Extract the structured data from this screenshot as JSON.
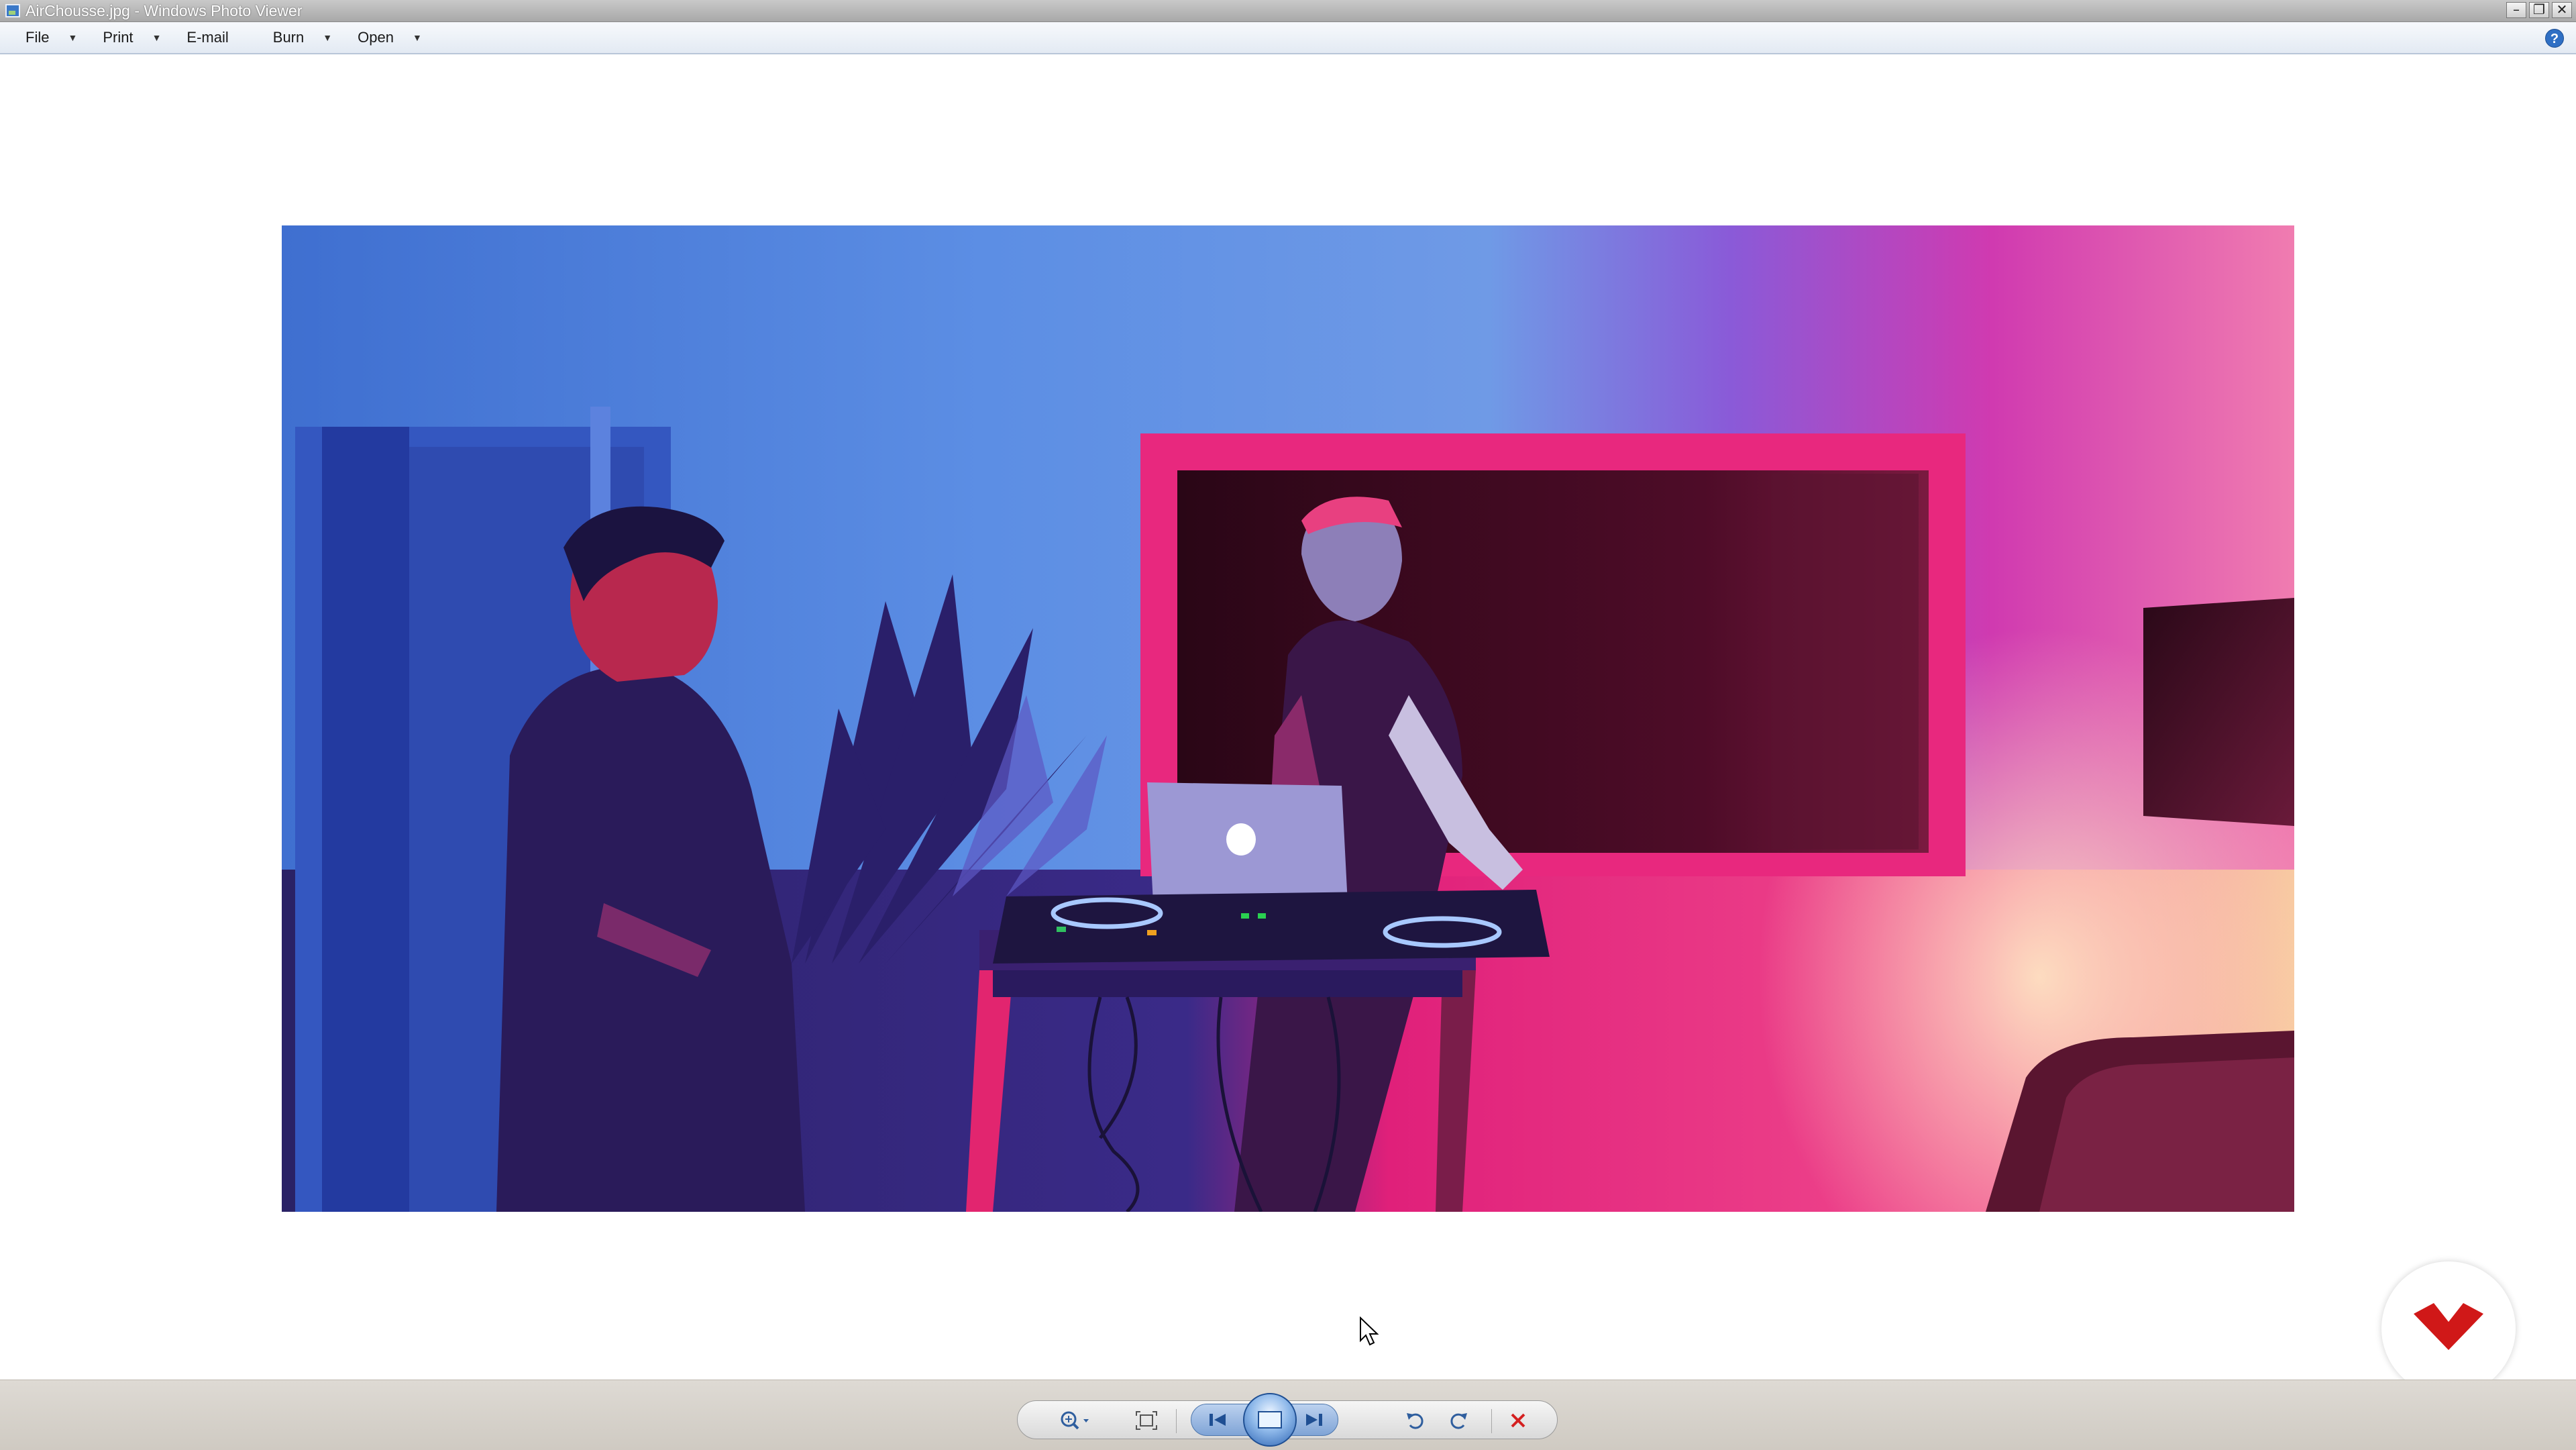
{
  "window": {
    "title": "AirChousse.jpg - Windows Photo Viewer",
    "controls": [
      "minimize-icon",
      "restore-icon",
      "close-icon"
    ]
  },
  "menu": {
    "file": "File",
    "print": "Print",
    "email": "E-mail",
    "burn": "Burn",
    "open": "Open",
    "help_icon": "help-icon"
  },
  "photo": {
    "description_icon": "image",
    "palette": {
      "blue": "#4f86e0",
      "deep_blue": "#2b3a9e",
      "navy": "#2a1e5c",
      "magenta": "#e8237c",
      "pink": "#f060a0",
      "cream": "#f8e6b0",
      "maroon": "#4a0a26"
    }
  },
  "toolbar": {
    "buttons": [
      "zoom-icon",
      "actual-size-icon",
      "previous-icon",
      "slideshow-icon",
      "next-icon",
      "rotate-left-icon",
      "rotate-right-icon",
      "delete-icon"
    ],
    "accent": "#2f5e9e",
    "delete_color": "#d42020"
  },
  "watermark": {
    "color": "#d01818"
  }
}
